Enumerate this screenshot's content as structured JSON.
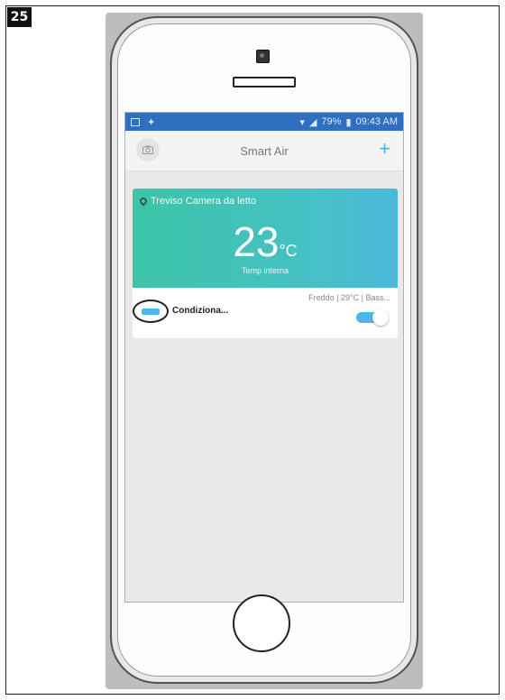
{
  "figure": {
    "step_number": "25"
  },
  "statusbar": {
    "battery": "79%",
    "time": "09:43 AM"
  },
  "appbar": {
    "title": "Smart Air",
    "camera_icon": "camera-icon",
    "add_icon": "plus-icon",
    "add_label": "+"
  },
  "card": {
    "location": "Treviso Camera da letto",
    "temperature": "23",
    "temperature_unit": "°C",
    "temperature_caption": "Temp interna",
    "device_status": "Freddo | 29°C | Bass...",
    "device_name": "Condiziona...",
    "device_icon": "air-conditioner-icon",
    "power_on": true
  },
  "colors": {
    "statusbar": "#2f6fbf",
    "card_gradient_start": "#3cc4a6",
    "card_gradient_end": "#4cb8d9",
    "accent": "#4fb6e8"
  }
}
